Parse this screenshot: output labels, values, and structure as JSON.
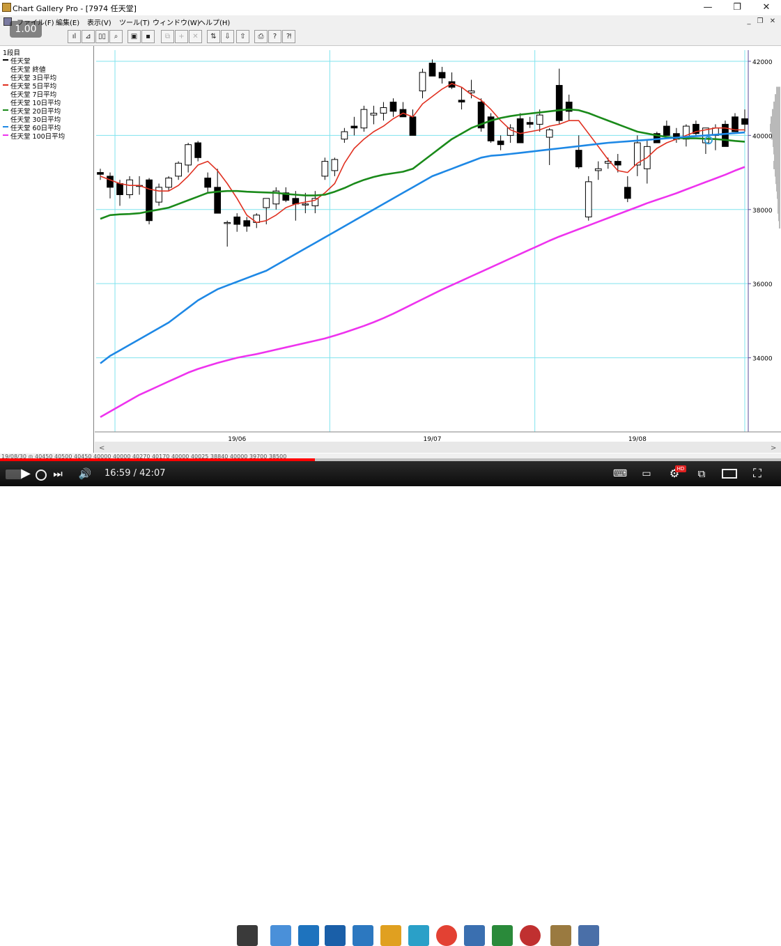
{
  "window": {
    "title": "Chart Gallery Pro - [7974 任天堂]",
    "minimize": "—",
    "restore": "❐",
    "close": "✕"
  },
  "menu": {
    "items": [
      "ファイル(F)",
      "編集(E)",
      "表示(V)",
      "ツール(T)",
      "ウィンドウ(W)",
      "ヘルプ(H)"
    ],
    "mdi_min": "_",
    "mdi_restore": "❐",
    "mdi_close": "✕"
  },
  "toolbar": {
    "buttons": [
      {
        "icon": "candle-chart-icon",
        "glyph": "ıl",
        "enabled": true
      },
      {
        "icon": "line-chart-icon",
        "glyph": "⊿",
        "enabled": true
      },
      {
        "icon": "bar-chart-icon",
        "glyph": "▯▯",
        "enabled": true
      },
      {
        "icon": "binoculars-icon",
        "glyph": "⌕",
        "enabled": true
      },
      {
        "icon": "open-folder-icon",
        "glyph": "▣",
        "enabled": true
      },
      {
        "icon": "save-disk-icon",
        "glyph": "▪",
        "enabled": true
      },
      {
        "icon": "copy-icon",
        "glyph": "⧉",
        "enabled": false
      },
      {
        "icon": "add-icon",
        "glyph": "+",
        "enabled": false
      },
      {
        "icon": "delete-icon",
        "glyph": "✕",
        "enabled": false
      },
      {
        "icon": "drag-icon",
        "glyph": "⇅",
        "enabled": true
      },
      {
        "icon": "arrow-down-icon",
        "glyph": "⇩",
        "enabled": true
      },
      {
        "icon": "arrow-up-icon",
        "glyph": "⇧",
        "enabled": true
      },
      {
        "icon": "print-icon",
        "glyph": "⎙",
        "enabled": true
      },
      {
        "icon": "help-icon",
        "glyph": "?",
        "enabled": true
      },
      {
        "icon": "context-help-icon",
        "glyph": "⁈",
        "enabled": true
      }
    ]
  },
  "video_overlay": {
    "speed": "1.00"
  },
  "legend": {
    "header": "1段目",
    "rows": [
      {
        "label": "任天堂",
        "color": "#000000",
        "marker": true
      },
      {
        "label": "任天堂 終値",
        "color": "",
        "marker": false
      },
      {
        "label": "任天堂 3日平均",
        "color": "",
        "marker": false
      },
      {
        "label": "任天堂 5日平均",
        "color": "#e03020",
        "marker": true
      },
      {
        "label": "任天堂 7日平均",
        "color": "",
        "marker": false
      },
      {
        "label": "任天堂 10日平均",
        "color": "",
        "marker": false
      },
      {
        "label": "任天堂 20日平均",
        "color": "#1a8a1a",
        "marker": true
      },
      {
        "label": "任天堂 30日平均",
        "color": "",
        "marker": false
      },
      {
        "label": "任天堂 60日平均",
        "color": "#1e88e5",
        "marker": true
      },
      {
        "label": "任天堂 100日平均",
        "color": "#ee33ee",
        "marker": true
      }
    ]
  },
  "chart_data": {
    "type": "line",
    "ylim": [
      32000,
      42300
    ],
    "yticks": [
      34000,
      36000,
      38000,
      40000,
      42000
    ],
    "ytick_labels": [
      "34000",
      "36000",
      "38000",
      "40000",
      "42000"
    ],
    "xtick_labels": [
      "19/06",
      "19/07",
      "19/08"
    ],
    "xtick_index": [
      14,
      34,
      55
    ],
    "n": 67,
    "candles": [
      [
        39000,
        39100,
        38800,
        38950
      ],
      [
        38900,
        39000,
        38300,
        38600
      ],
      [
        38700,
        38800,
        38100,
        38400
      ],
      [
        38400,
        38900,
        38300,
        38800
      ],
      [
        38650,
        38900,
        38400,
        38650
      ],
      [
        38800,
        38850,
        37600,
        37700
      ],
      [
        38200,
        38700,
        38100,
        38600
      ],
      [
        38600,
        38900,
        38500,
        38850
      ],
      [
        38900,
        39300,
        38800,
        39250
      ],
      [
        39200,
        39800,
        39000,
        39750
      ],
      [
        39800,
        39850,
        39300,
        39400
      ],
      [
        38850,
        39000,
        38450,
        38600
      ],
      [
        38600,
        39100,
        37900,
        37900
      ],
      [
        37650,
        37700,
        37000,
        37650
      ],
      [
        37800,
        37900,
        37400,
        37600
      ],
      [
        37700,
        37800,
        37400,
        37550
      ],
      [
        37650,
        37900,
        37500,
        37850
      ],
      [
        38050,
        38300,
        37600,
        38300
      ],
      [
        38150,
        38600,
        38000,
        38500
      ],
      [
        38450,
        38600,
        38200,
        38250
      ],
      [
        38300,
        38500,
        37700,
        38150
      ],
      [
        38150,
        38450,
        37900,
        38150
      ],
      [
        38100,
        38500,
        37900,
        38300
      ],
      [
        38900,
        39400,
        38800,
        39300
      ],
      [
        39050,
        39400,
        38900,
        39350
      ],
      [
        39900,
        40200,
        39800,
        40100
      ],
      [
        40250,
        40500,
        40000,
        40200
      ],
      [
        40200,
        40800,
        40100,
        40700
      ],
      [
        40550,
        40800,
        40300,
        40600
      ],
      [
        40600,
        40900,
        40400,
        40750
      ],
      [
        40900,
        41000,
        40500,
        40650
      ],
      [
        40700,
        40900,
        40500,
        40500
      ],
      [
        40500,
        40700,
        40000,
        40000
      ],
      [
        41200,
        41800,
        41000,
        41700
      ],
      [
        41950,
        42050,
        41600,
        41600
      ],
      [
        41700,
        41850,
        41400,
        41550
      ],
      [
        41450,
        41700,
        41250,
        41300
      ],
      [
        40950,
        41300,
        40700,
        40900
      ],
      [
        41150,
        41500,
        41000,
        41200
      ],
      [
        40900,
        41000,
        40100,
        40200
      ],
      [
        40500,
        40600,
        39800,
        39850
      ],
      [
        39850,
        40000,
        39600,
        39750
      ],
      [
        40000,
        40300,
        39800,
        40200
      ],
      [
        40450,
        40600,
        39800,
        39800
      ],
      [
        40350,
        40500,
        40200,
        40300
      ],
      [
        40300,
        40700,
        40100,
        40550
      ],
      [
        39950,
        40200,
        39200,
        40150
      ],
      [
        41350,
        41800,
        40300,
        40400
      ],
      [
        40900,
        41100,
        40400,
        40650
      ],
      [
        39600,
        40000,
        39100,
        39150
      ],
      [
        37800,
        38900,
        37700,
        38750
      ],
      [
        39050,
        39300,
        38800,
        39100
      ],
      [
        39250,
        39400,
        39100,
        39300
      ],
      [
        39300,
        39500,
        39000,
        39200
      ],
      [
        38600,
        38900,
        38200,
        38300
      ],
      [
        39200,
        40000,
        38900,
        39800
      ],
      [
        39100,
        39900,
        38700,
        39700
      ],
      [
        40050,
        40100,
        39800,
        39800
      ],
      [
        40250,
        40400,
        40000,
        40000
      ],
      [
        40050,
        40200,
        39800,
        39900
      ],
      [
        39900,
        40300,
        39700,
        40250
      ],
      [
        40300,
        40400,
        40000,
        40050
      ],
      [
        39800,
        40200,
        39500,
        40200
      ],
      [
        40000,
        40300,
        39600,
        40200
      ],
      [
        40300,
        40400,
        39700,
        39700
      ],
      [
        40500,
        40600,
        40100,
        40100
      ],
      [
        40450,
        40700,
        40100,
        40300
      ]
    ],
    "series": [
      {
        "name": "任天堂 5日平均",
        "color": "#e03020",
        "values": [
          38900,
          38800,
          38700,
          38650,
          38650,
          38550,
          38500,
          38500,
          38650,
          38900,
          39200,
          39300,
          39050,
          38700,
          38300,
          37850,
          37650,
          37700,
          37850,
          38050,
          38150,
          38200,
          38250,
          38450,
          38700,
          39250,
          39650,
          39900,
          40100,
          40250,
          40450,
          40600,
          40500,
          40850,
          41050,
          41250,
          41400,
          41300,
          41100,
          40950,
          40700,
          40400,
          40150,
          40050,
          40100,
          40150,
          40250,
          40300,
          40400,
          40400,
          40050,
          39700,
          39350,
          39050,
          39000,
          39250,
          39400,
          39650,
          39800,
          39900,
          40000,
          40100,
          40150,
          40200,
          40200,
          40150,
          40150
        ]
      },
      {
        "name": "任天堂 20日平均",
        "color": "#1a8a1a",
        "values": [
          37750,
          37850,
          37870,
          37880,
          37900,
          37950,
          38000,
          38050,
          38150,
          38250,
          38350,
          38450,
          38480,
          38500,
          38500,
          38480,
          38470,
          38460,
          38450,
          38420,
          38400,
          38380,
          38380,
          38400,
          38480,
          38580,
          38700,
          38800,
          38880,
          38940,
          38980,
          39020,
          39100,
          39300,
          39500,
          39700,
          39900,
          40050,
          40200,
          40300,
          40400,
          40470,
          40520,
          40560,
          40590,
          40620,
          40650,
          40680,
          40700,
          40680,
          40600,
          40500,
          40400,
          40300,
          40200,
          40100,
          40050,
          40000,
          39960,
          39930,
          39920,
          39920,
          39910,
          39900,
          39880,
          39850,
          39830
        ]
      },
      {
        "name": "任天堂 60日平均",
        "color": "#1e88e5",
        "values": [
          33850,
          34050,
          34200,
          34350,
          34500,
          34650,
          34800,
          34950,
          35150,
          35350,
          35550,
          35700,
          35850,
          35950,
          36050,
          36150,
          36250,
          36350,
          36500,
          36650,
          36800,
          36950,
          37100,
          37250,
          37400,
          37550,
          37700,
          37850,
          38000,
          38150,
          38300,
          38450,
          38600,
          38750,
          38900,
          39000,
          39100,
          39200,
          39300,
          39400,
          39450,
          39470,
          39500,
          39530,
          39560,
          39590,
          39620,
          39650,
          39680,
          39710,
          39740,
          39770,
          39800,
          39820,
          39840,
          39860,
          39880,
          39900,
          39920,
          39940,
          39960,
          39980,
          40000,
          40020,
          40040,
          40060,
          40080
        ]
      },
      {
        "name": "任天堂 100日平均",
        "color": "#ee33ee",
        "values": [
          32400,
          32550,
          32700,
          32850,
          33000,
          33120,
          33240,
          33360,
          33480,
          33600,
          33700,
          33780,
          33860,
          33930,
          34000,
          34050,
          34100,
          34160,
          34220,
          34280,
          34340,
          34400,
          34460,
          34520,
          34600,
          34680,
          34770,
          34860,
          34960,
          35070,
          35190,
          35320,
          35450,
          35580,
          35710,
          35840,
          35960,
          36080,
          36200,
          36320,
          36440,
          36560,
          36680,
          36800,
          36920,
          37040,
          37160,
          37270,
          37370,
          37470,
          37570,
          37670,
          37770,
          37870,
          37970,
          38070,
          38170,
          38260,
          38350,
          38440,
          38540,
          38640,
          38740,
          38840,
          38940,
          39050,
          39150
        ]
      }
    ]
  },
  "status": {
    "text": "19/08/30 ◎ 40450 40500 40450 40000 40000 40270 40170 40000 40025 38840 40000 39700 38500"
  },
  "player": {
    "time": "16:59 / 42:07",
    "progress": 0.403,
    "play_icon": "▶",
    "next_icon": "⏭",
    "volume_icon": "🔊",
    "settings_icon": "⚙",
    "hd_badge": "HD",
    "miniplayer_icon": "⧉",
    "fullscreen_icon": "⛶"
  }
}
